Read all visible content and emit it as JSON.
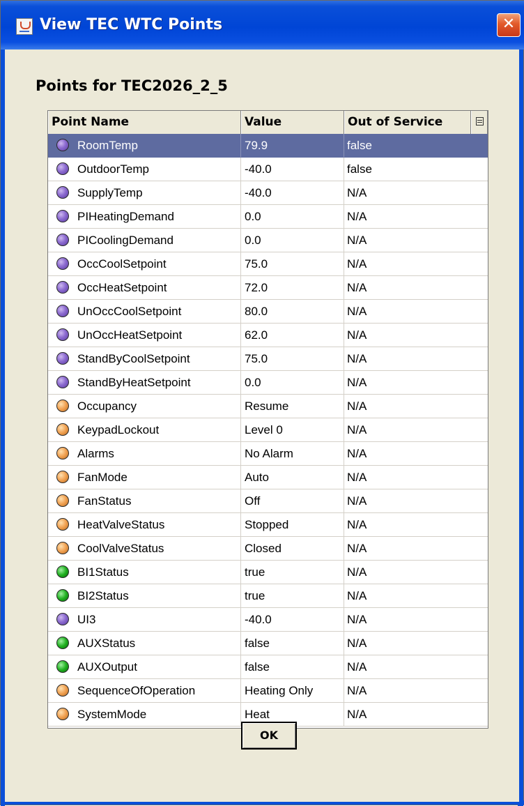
{
  "window": {
    "title": "View TEC WTC Points",
    "close_label": "✕"
  },
  "heading": "Points for TEC2026_2_5",
  "table": {
    "columns": [
      "Point Name",
      "Value",
      "Out of Service"
    ],
    "rows": [
      {
        "name": "RoomTemp",
        "value": "79.9",
        "oos": "false",
        "color": "purple",
        "selected": true
      },
      {
        "name": "OutdoorTemp",
        "value": "-40.0",
        "oos": "false",
        "color": "purple"
      },
      {
        "name": "SupplyTemp",
        "value": "-40.0",
        "oos": "N/A",
        "color": "purple"
      },
      {
        "name": "PIHeatingDemand",
        "value": "0.0",
        "oos": "N/A",
        "color": "purple"
      },
      {
        "name": "PICoolingDemand",
        "value": "0.0",
        "oos": "N/A",
        "color": "purple"
      },
      {
        "name": "OccCoolSetpoint",
        "value": "75.0",
        "oos": "N/A",
        "color": "purple"
      },
      {
        "name": "OccHeatSetpoint",
        "value": "72.0",
        "oos": "N/A",
        "color": "purple"
      },
      {
        "name": "UnOccCoolSetpoint",
        "value": "80.0",
        "oos": "N/A",
        "color": "purple"
      },
      {
        "name": "UnOccHeatSetpoint",
        "value": "62.0",
        "oos": "N/A",
        "color": "purple"
      },
      {
        "name": "StandByCoolSetpoint",
        "value": "75.0",
        "oos": "N/A",
        "color": "purple"
      },
      {
        "name": "StandByHeatSetpoint",
        "value": "0.0",
        "oos": "N/A",
        "color": "purple"
      },
      {
        "name": "Occupancy",
        "value": "Resume",
        "oos": "N/A",
        "color": "orange"
      },
      {
        "name": "KeypadLockout",
        "value": "Level 0",
        "oos": "N/A",
        "color": "orange"
      },
      {
        "name": "Alarms",
        "value": "No Alarm",
        "oos": "N/A",
        "color": "orange"
      },
      {
        "name": "FanMode",
        "value": "Auto",
        "oos": "N/A",
        "color": "orange"
      },
      {
        "name": "FanStatus",
        "value": "Off",
        "oos": "N/A",
        "color": "orange"
      },
      {
        "name": "HeatValveStatus",
        "value": "Stopped",
        "oos": "N/A",
        "color": "orange"
      },
      {
        "name": "CoolValveStatus",
        "value": "Closed",
        "oos": "N/A",
        "color": "orange"
      },
      {
        "name": "BI1Status",
        "value": "true",
        "oos": "N/A",
        "color": "green"
      },
      {
        "name": "BI2Status",
        "value": "true",
        "oos": "N/A",
        "color": "green"
      },
      {
        "name": "UI3",
        "value": "-40.0",
        "oos": "N/A",
        "color": "purple"
      },
      {
        "name": "AUXStatus",
        "value": "false",
        "oos": "N/A",
        "color": "green"
      },
      {
        "name": "AUXOutput",
        "value": "false",
        "oos": "N/A",
        "color": "green"
      },
      {
        "name": "SequenceOfOperation",
        "value": "Heating Only",
        "oos": "N/A",
        "color": "orange"
      },
      {
        "name": "SystemMode",
        "value": "Heat",
        "oos": "N/A",
        "color": "orange"
      }
    ]
  },
  "ok_label": "OK"
}
